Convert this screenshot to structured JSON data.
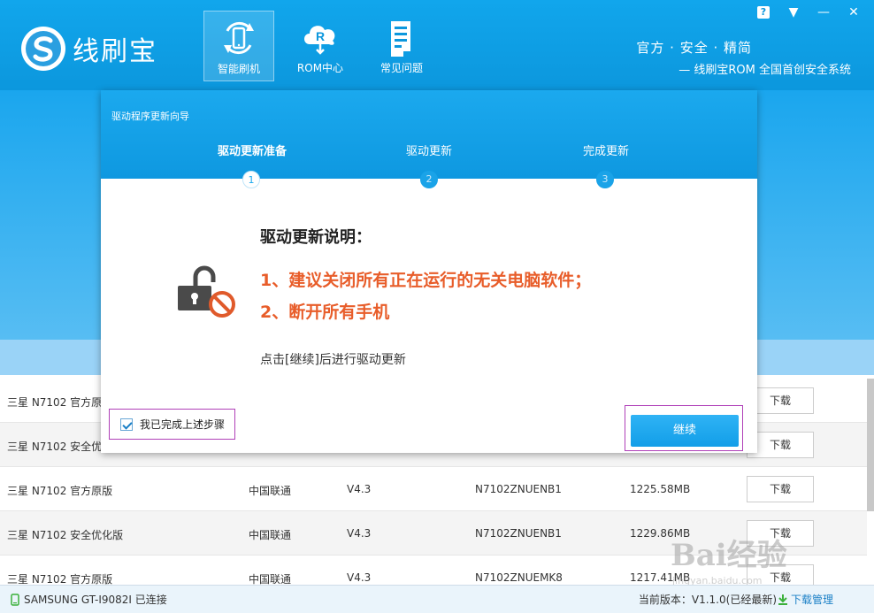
{
  "app": {
    "logo_text": "线刷宝",
    "slogan_main": "官方 · 安全 · 精简",
    "slogan_sub": "— 线刷宝ROM 全国首创安全系统",
    "accent": "#0c97dd"
  },
  "nav": {
    "items": [
      {
        "label": "智能刷机",
        "icon": "phone-refresh-icon",
        "active": true
      },
      {
        "label": "ROM中心",
        "icon": "cloud-r-icon",
        "active": false
      },
      {
        "label": "常见问题",
        "icon": "document-icon",
        "active": false
      }
    ]
  },
  "window": {
    "help": "?",
    "menu": "▼",
    "minimize": "—",
    "close": "✕"
  },
  "dialog": {
    "title": "驱动程序更新向导",
    "steps": [
      {
        "label": "驱动更新准备",
        "num": "1",
        "active": true
      },
      {
        "label": "驱动更新",
        "num": "2",
        "active": false
      },
      {
        "label": "完成更新",
        "num": "3",
        "active": false
      }
    ],
    "instruction_title": "驱动更新说明：",
    "instruction_1": "1、建议关闭所有正在运行的无关电脑软件；",
    "instruction_2": "2、断开所有手机",
    "hint": "点击[继续]后进行驱动更新",
    "agree_label": "我已完成上述步骤",
    "agree_checked": true,
    "continue_label": "继续",
    "highlight_color": "#e85d2a"
  },
  "table": {
    "rows": [
      {
        "name": "三星 N7102 官方原",
        "operator": "",
        "version": "",
        "build": "",
        "size": "",
        "action": "下载"
      },
      {
        "name": "三星 N7102 安全优",
        "operator": "",
        "version": "",
        "build": "",
        "size": "",
        "action": "下载"
      },
      {
        "name": "三星 N7102 官方原版",
        "operator": "中国联通",
        "version": "V4.3",
        "build": "N7102ZNUENB1",
        "size": "1225.58MB",
        "action": "下载"
      },
      {
        "name": "三星 N7102 安全优化版",
        "operator": "中国联通",
        "version": "V4.3",
        "build": "N7102ZNUENB1",
        "size": "1229.86MB",
        "action": "下载"
      },
      {
        "name": "三星 N7102 官方原版",
        "operator": "中国联通",
        "version": "V4.3",
        "build": "N7102ZNUEMK8",
        "size": "1217.41MB",
        "action": "下载"
      }
    ]
  },
  "footer": {
    "device": "SAMSUNG GT-I9082I 已连接",
    "version": "当前版本：V1.1.0(已经最新)",
    "download_manager": "下载管理"
  },
  "watermark": {
    "text": "Bai经验",
    "url": "jingyan.baidu.com"
  }
}
